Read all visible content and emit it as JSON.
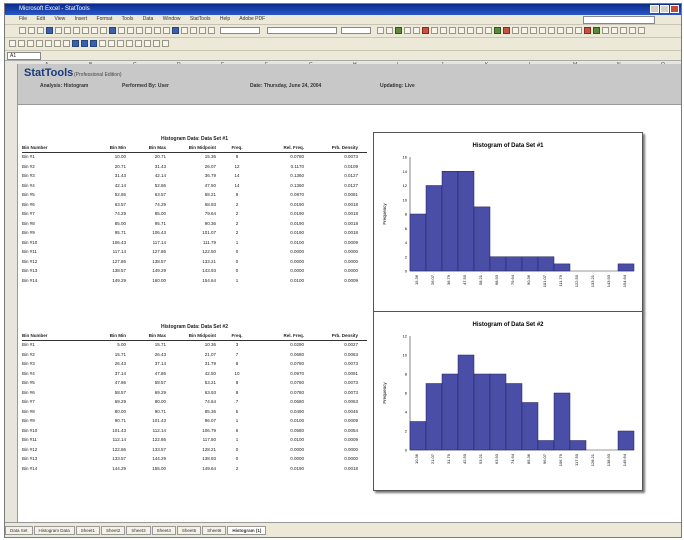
{
  "window": {
    "title": "Microsoft Excel - StatTools"
  },
  "menu": [
    "File",
    "Edit",
    "View",
    "Insert",
    "Format",
    "Tools",
    "Data",
    "Window",
    "StatTools",
    "Help",
    "Adobe PDF"
  ],
  "header": {
    "brand": "StatTools",
    "brand_sub": "(Professional Edition)",
    "labels": [
      "Analysis: Histogram",
      "Performed By: User",
      "Date: Thursday, June 24, 2004",
      "Updating: Live"
    ]
  },
  "namebox": "A1",
  "tables": [
    {
      "title": "Histogram Data: Data Set #1",
      "columns": [
        "Bin Number",
        "Bin Min",
        "Bin Max",
        "Bin Midpoint",
        "Freq.",
        "Rel. Freq.",
        "Prb. Density"
      ],
      "rows": [
        [
          "Bin #1",
          "10.00",
          "20.71",
          "15.36",
          "8",
          "0.0780",
          "0.0073"
        ],
        [
          "Bin #2",
          "20.71",
          "31.43",
          "26.07",
          "12",
          "0.1170",
          "0.0109"
        ],
        [
          "Bin #3",
          "31.43",
          "42.14",
          "36.79",
          "14",
          "0.1360",
          "0.0127"
        ],
        [
          "Bin #4",
          "42.14",
          "52.86",
          "47.50",
          "14",
          "0.1360",
          "0.0127"
        ],
        [
          "Bin #5",
          "52.86",
          "63.57",
          "58.21",
          "9",
          "0.0870",
          "0.0081"
        ],
        [
          "Bin #6",
          "63.57",
          "74.29",
          "68.93",
          "2",
          "0.0190",
          "0.0018"
        ],
        [
          "Bin #7",
          "74.29",
          "85.00",
          "79.64",
          "2",
          "0.0190",
          "0.0018"
        ],
        [
          "Bin #8",
          "85.00",
          "95.71",
          "90.36",
          "2",
          "0.0190",
          "0.0018"
        ],
        [
          "Bin #9",
          "95.71",
          "106.43",
          "101.07",
          "2",
          "0.0190",
          "0.0018"
        ],
        [
          "Bin #10",
          "106.43",
          "117.14",
          "111.79",
          "1",
          "0.0100",
          "0.0009"
        ],
        [
          "Bin #11",
          "117.14",
          "127.86",
          "122.50",
          "0",
          "0.0000",
          "0.0000"
        ],
        [
          "Bin #12",
          "127.86",
          "138.57",
          "133.21",
          "0",
          "0.0000",
          "0.0000"
        ],
        [
          "Bin #13",
          "138.57",
          "149.29",
          "143.93",
          "0",
          "0.0000",
          "0.0000"
        ],
        [
          "Bin #14",
          "149.29",
          "160.00",
          "154.64",
          "1",
          "0.0100",
          "0.0009"
        ]
      ]
    },
    {
      "title": "Histogram Data: Data Set #2",
      "columns": [
        "Bin Number",
        "Bin Min",
        "Bin Max",
        "Bin Midpoint",
        "Freq.",
        "Rel. Freq.",
        "Prb. Density"
      ],
      "rows": [
        [
          "Bin #1",
          "5.00",
          "15.71",
          "10.36",
          "3",
          "0.0290",
          "0.0027"
        ],
        [
          "Bin #2",
          "15.71",
          "26.43",
          "21.07",
          "7",
          "0.0680",
          "0.0063"
        ],
        [
          "Bin #3",
          "26.43",
          "37.14",
          "31.79",
          "8",
          "0.0780",
          "0.0073"
        ],
        [
          "Bin #4",
          "37.14",
          "47.86",
          "42.50",
          "10",
          "0.0970",
          "0.0091"
        ],
        [
          "Bin #5",
          "47.86",
          "58.57",
          "53.21",
          "8",
          "0.0780",
          "0.0073"
        ],
        [
          "Bin #6",
          "58.57",
          "69.29",
          "63.93",
          "8",
          "0.0780",
          "0.0073"
        ],
        [
          "Bin #7",
          "69.29",
          "80.00",
          "74.64",
          "7",
          "0.0680",
          "0.0063"
        ],
        [
          "Bin #8",
          "80.00",
          "90.71",
          "85.36",
          "5",
          "0.0490",
          "0.0045"
        ],
        [
          "Bin #9",
          "90.71",
          "101.43",
          "96.07",
          "1",
          "0.0100",
          "0.0009"
        ],
        [
          "Bin #10",
          "101.43",
          "112.14",
          "106.79",
          "6",
          "0.0580",
          "0.0054"
        ],
        [
          "Bin #11",
          "112.14",
          "122.86",
          "117.50",
          "1",
          "0.0100",
          "0.0009"
        ],
        [
          "Bin #12",
          "122.86",
          "133.57",
          "128.21",
          "0",
          "0.0000",
          "0.0000"
        ],
        [
          "Bin #13",
          "133.57",
          "144.29",
          "138.93",
          "0",
          "0.0000",
          "0.0000"
        ],
        [
          "Bin #14",
          "144.29",
          "155.00",
          "149.64",
          "2",
          "0.0190",
          "0.0018"
        ]
      ]
    }
  ],
  "chart_data": [
    {
      "type": "bar",
      "title": "Histogram of Data Set #1",
      "ylabel": "Frequency",
      "xlabel": "",
      "categories": [
        "15.36",
        "26.07",
        "36.79",
        "47.50",
        "58.21",
        "68.93",
        "79.64",
        "90.36",
        "101.07",
        "111.79",
        "122.50",
        "133.21",
        "143.93",
        "154.64"
      ],
      "values": [
        8,
        12,
        14,
        14,
        9,
        2,
        2,
        2,
        2,
        1,
        0,
        0,
        0,
        1
      ],
      "ylim": [
        0,
        16
      ],
      "yticks": [
        0,
        2,
        4,
        6,
        8,
        10,
        12,
        14,
        16
      ],
      "color": "#4a4ea6"
    },
    {
      "type": "bar",
      "title": "Histogram of Data Set #2",
      "ylabel": "Frequency",
      "xlabel": "",
      "categories": [
        "10.36",
        "21.07",
        "31.79",
        "42.50",
        "53.21",
        "63.93",
        "74.64",
        "85.36",
        "96.07",
        "106.79",
        "117.50",
        "128.21",
        "138.93",
        "149.64"
      ],
      "values": [
        3,
        7,
        8,
        10,
        8,
        8,
        7,
        5,
        1,
        6,
        1,
        0,
        0,
        2
      ],
      "ylim": [
        0,
        12
      ],
      "yticks": [
        0,
        2,
        4,
        6,
        8,
        10,
        12
      ],
      "color": "#4a4ea6"
    }
  ],
  "sheet_tabs": [
    "Data Set",
    "Histogram Data",
    "Sheet1",
    "Sheet2",
    "Sheet3",
    "Sheet4",
    "Sheet5",
    "Sheet6",
    "Histogram (1)"
  ],
  "active_tab_index": 8
}
